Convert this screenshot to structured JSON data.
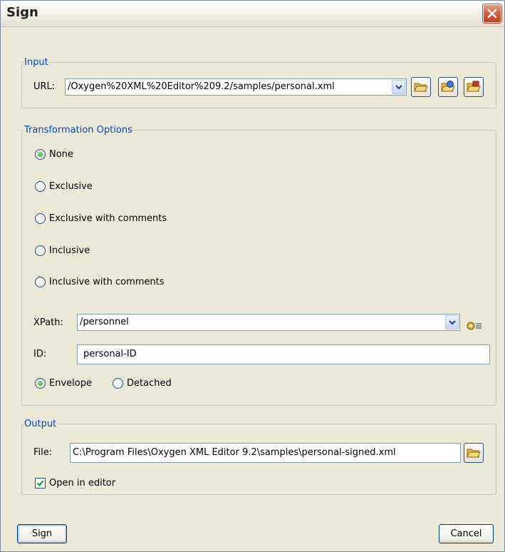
{
  "window": {
    "title": "Sign"
  },
  "input": {
    "legend": "Input",
    "url_label": "URL:",
    "url_value": "/Oxygen%20XML%20Editor%209.2/samples/personal.xml",
    "buttons": [
      "open-folder-icon",
      "browse-url-icon",
      "open-archive-icon"
    ]
  },
  "transformation": {
    "legend": "Transformation Options",
    "options": [
      {
        "label": "None",
        "selected": true
      },
      {
        "label": "Exclusive",
        "selected": false
      },
      {
        "label": "Exclusive with comments",
        "selected": false
      },
      {
        "label": "Inclusive",
        "selected": false
      },
      {
        "label": "Inclusive with comments",
        "selected": false
      }
    ],
    "xpath_label": "XPath:",
    "xpath_value": "/personnel",
    "id_label": "ID:",
    "id_value": "personal-ID",
    "envelope_label": "Envelope",
    "detached_label": "Detached",
    "envelope_selected": true
  },
  "output": {
    "legend": "Output",
    "file_label": "File:",
    "file_value": "C:\\Program Files\\Oxygen XML Editor 9.2\\samples\\personal-signed.xml",
    "open_in_editor_label": "Open in editor",
    "open_in_editor_checked": true
  },
  "buttons": {
    "sign": "Sign",
    "cancel": "Cancel"
  }
}
